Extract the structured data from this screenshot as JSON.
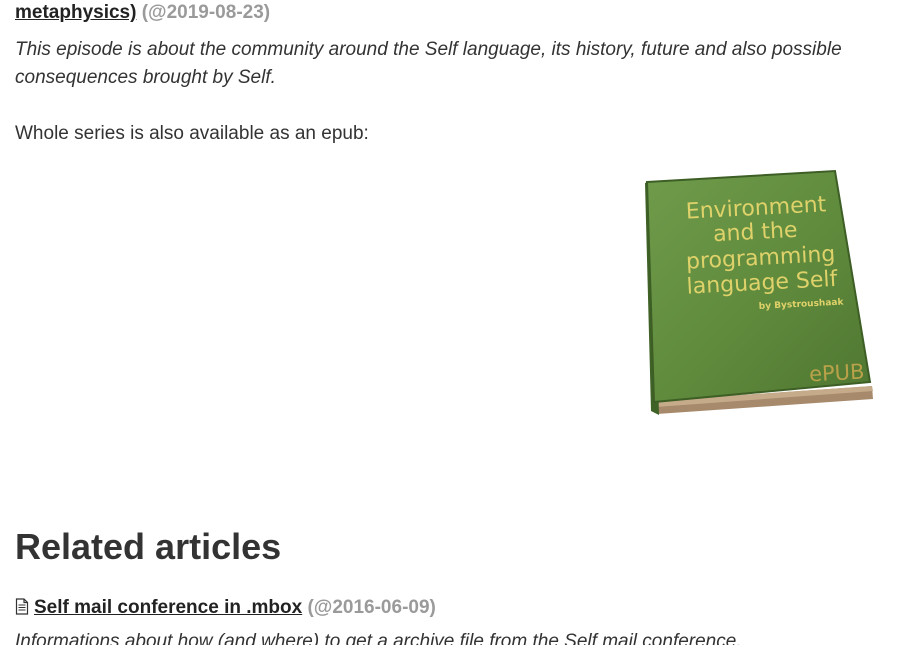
{
  "entry": {
    "title_tail": "metaphysics)",
    "date": "(@2019-08-23)",
    "description": "This episode is about the community around the Self language, its history, future and also possible consequences brought by Self."
  },
  "epub": {
    "note": "Whole series is also available as an epub:",
    "cover": {
      "title_lines": [
        "Environment",
        "and the",
        "programming",
        "language Self"
      ],
      "author": "by Bystroushaak",
      "badge": "ePUB"
    }
  },
  "related": {
    "heading": "Related articles",
    "items": [
      {
        "icon": "document-icon",
        "title": "Self mail conference in .mbox",
        "date": "(@2016-06-09)",
        "description": "Informations about how (and where) to get a archive file from the Self mail conference."
      }
    ]
  }
}
